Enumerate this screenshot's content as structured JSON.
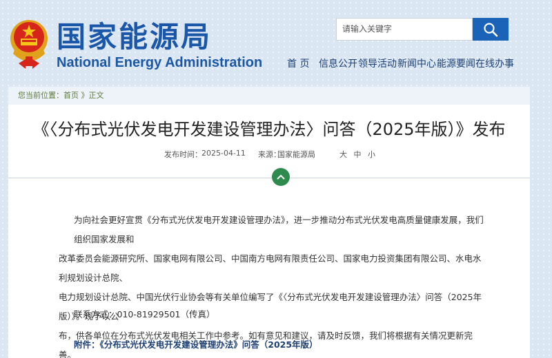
{
  "header": {
    "site_name_cn": "国家能源局",
    "site_name_en": "National Energy Administration",
    "search_placeholder": "请输入关键字"
  },
  "nav": {
    "items": [
      "首 页",
      "信息公开",
      "领导活动",
      "新闻中心",
      "能源要闻",
      "在线办事"
    ]
  },
  "breadcrumb": {
    "prefix": "您当前位置：",
    "home": "首页",
    "separator": " 》",
    "current": "正文"
  },
  "article": {
    "title": "《〈分布式光伏发电开发建设管理办法〉问答（2025年版）》发布",
    "date_label": "发布时间：",
    "date": "2025-04-11",
    "source_label": "来源：",
    "source": "国家能源局",
    "font_sizes": "大 中 小",
    "paragraph_lines": [
      "为向社会更好宣贯《分布式光伏发电开发建设管理办法》，进一步推动分布式光伏发电高质量健康发展，我们组织国家发展和",
      "改革委员会能源研究所、国家电网有限公司、中国南方电网有限责任公司、国家电力投资集团有限公司、水电水利规划设计总院、",
      "电力规划设计总院、中国光伏行业协会等有关单位编写了《〈分布式光伏发电开发建设管理办法〉问答（2025年版）》。现予以公",
      "布，供各单位在分布式光伏发电相关工作中参考。如有意见和建议，请及时反馈，我们将根据有关情况更新完善。"
    ],
    "contact": "联系方式：010-81929501（传真）",
    "attachment": "附件：《分布式光伏发电开发建设管理办法》问答（2025年版）"
  },
  "colors": {
    "brand_blue": "#1b57a8",
    "nav_text": "#1c3f73",
    "crumb_green": "#5d7a3c",
    "up_button": "#2f8a4e"
  }
}
